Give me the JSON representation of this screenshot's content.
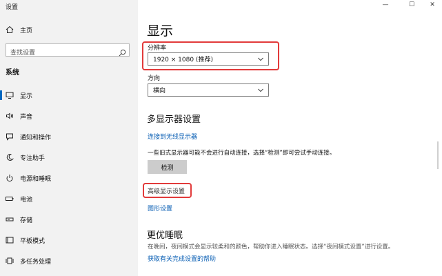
{
  "app": {
    "title": "设置"
  },
  "window_controls": {
    "minimize": "—",
    "maximize": "☐",
    "close": "✕"
  },
  "sidebar": {
    "home_label": "主页",
    "search_placeholder": "查找设置",
    "section_label": "系统",
    "items": [
      {
        "label": "显示",
        "icon": "monitor-icon",
        "active": true
      },
      {
        "label": "声音",
        "icon": "speaker-icon"
      },
      {
        "label": "通知和操作",
        "icon": "notification-icon"
      },
      {
        "label": "专注助手",
        "icon": "moon-icon"
      },
      {
        "label": "电源和睡眠",
        "icon": "power-icon"
      },
      {
        "label": "电池",
        "icon": "battery-icon"
      },
      {
        "label": "存储",
        "icon": "storage-icon"
      },
      {
        "label": "平板模式",
        "icon": "tablet-icon"
      },
      {
        "label": "多任务处理",
        "icon": "multitask-icon"
      }
    ]
  },
  "main": {
    "title": "显示",
    "resolution": {
      "label": "分辨率",
      "value": "1920 × 1080 (推荐)"
    },
    "orientation": {
      "label": "方向",
      "value": "横向"
    },
    "multi_display": {
      "heading": "多显示器设置",
      "connect_link": "连接到无线显示器",
      "description": "一些旧式显示器可能不会进行自动连接，选择“检测”即可尝试手动连接。",
      "detect_button": "检测"
    },
    "advanced_link": "高级显示设置",
    "graphics_link": "图形设置",
    "sleep": {
      "heading": "更优睡眠",
      "description": "在晚间，夜间模式会显示较柔和的颜色，帮助你进入睡眠状态。选择“夜间模式设置”进行设置。",
      "link": "获取有关完成设置的帮助"
    }
  },
  "colors": {
    "accent": "#0067c0",
    "link": "#0a5fb4",
    "highlight_box": "#e23a3a",
    "sidebar_bg": "#f2f2f2"
  }
}
